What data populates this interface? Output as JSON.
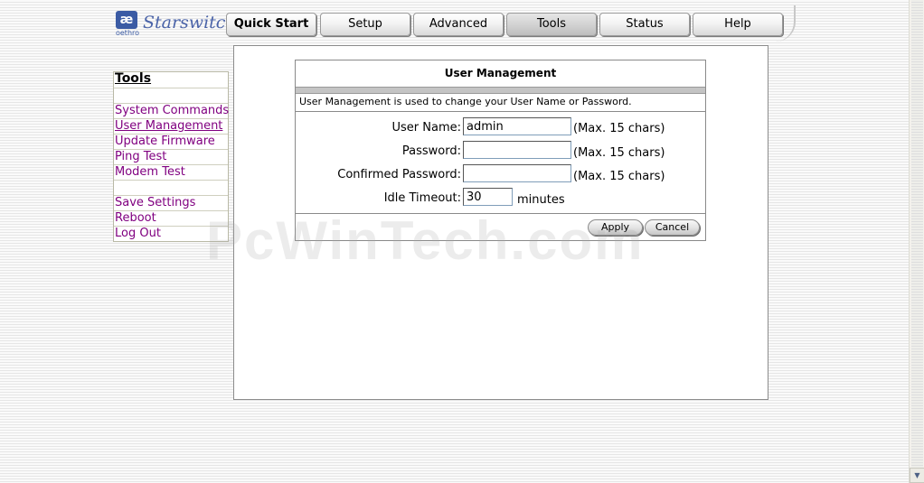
{
  "logo": {
    "mark": "æ",
    "brand": "oethro",
    "product": "Starswitch"
  },
  "nav": {
    "items": [
      {
        "label": "Quick Start"
      },
      {
        "label": "Setup"
      },
      {
        "label": "Advanced"
      },
      {
        "label": "Tools",
        "active": true
      },
      {
        "label": "Status"
      },
      {
        "label": "Help"
      }
    ]
  },
  "sidebar": {
    "title": "Tools",
    "items": [
      {
        "label": "System Commands"
      },
      {
        "label": "User Management",
        "current": true
      },
      {
        "label": "Update Firmware"
      },
      {
        "label": "Ping Test"
      },
      {
        "label": "Modem Test"
      }
    ],
    "actions": [
      {
        "label": "Save Settings"
      },
      {
        "label": "Reboot"
      },
      {
        "label": "Log Out"
      }
    ]
  },
  "form": {
    "title": "User Management",
    "description": "User Management is used to change your User Name or Password.",
    "username": {
      "label": "User Name:",
      "value": "admin",
      "hint": "(Max. 15 chars)"
    },
    "password": {
      "label": "Password:",
      "value": "",
      "hint": "(Max. 15 chars)"
    },
    "confirm": {
      "label": "Confirmed Password:",
      "value": "",
      "hint": "(Max. 15 chars)"
    },
    "timeout": {
      "label": "Idle Timeout:",
      "value": "30",
      "unit": "minutes"
    },
    "apply_label": "Apply",
    "cancel_label": "Cancel"
  },
  "watermark": "PcWinTech.com",
  "scrollbar": {
    "down_icon": "▼"
  },
  "colors": {
    "link": "#800080",
    "logo": "#3b5ba4"
  }
}
